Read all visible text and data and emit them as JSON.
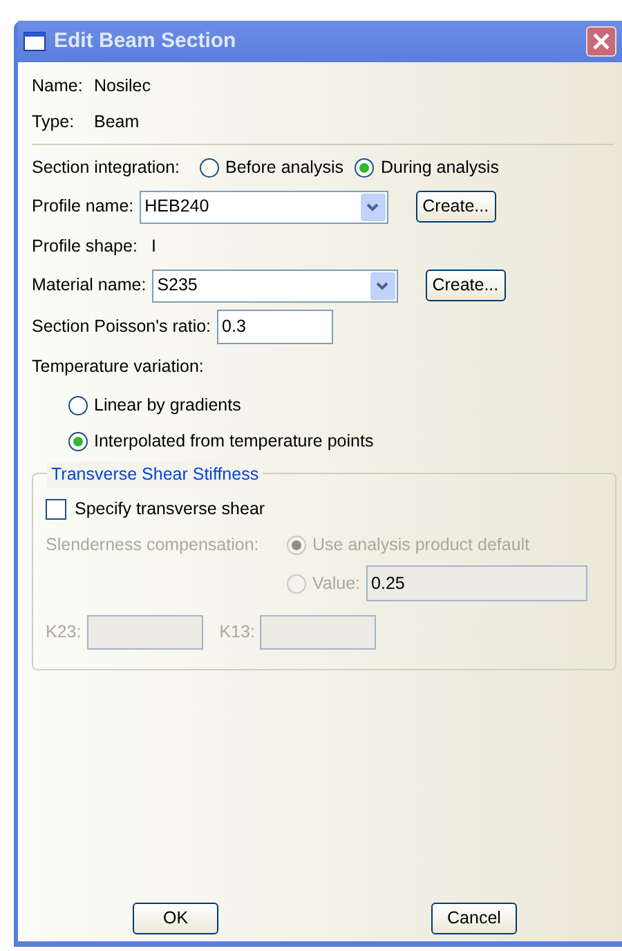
{
  "window": {
    "title": "Edit Beam Section"
  },
  "info": [
    {
      "label": "Name:",
      "value": "Nosilec"
    },
    {
      "label": "Type:",
      "value": "Beam"
    }
  ],
  "section_integration": {
    "label": "Section integration:",
    "options": [
      {
        "label": "Before analysis",
        "selected": false
      },
      {
        "label": "During analysis",
        "selected": true
      }
    ]
  },
  "profile_name": {
    "label": "Profile name:",
    "value": "HEB240",
    "button": "Create..."
  },
  "profile_shape": {
    "label": "Profile shape:",
    "value": "I"
  },
  "material_name": {
    "label": "Material name:",
    "value": "S235",
    "button": "Create..."
  },
  "poisson": {
    "label": "Section Poisson's ratio:",
    "value": "0.3"
  },
  "temperature_variation": {
    "label": "Temperature variation:",
    "options": [
      {
        "label": "Linear by gradients",
        "selected": false
      },
      {
        "label": "Interpolated from temperature points",
        "selected": true
      }
    ]
  },
  "transverse_shear": {
    "title": "Transverse Shear Stiffness",
    "specify": {
      "label": "Specify transverse shear",
      "checked": false
    },
    "disabled": true,
    "slenderness_label": "Slenderness compensation:",
    "options": [
      {
        "label": "Use analysis product default",
        "selected": true
      },
      {
        "label": "Value:",
        "selected": false,
        "value": "0.25"
      }
    ],
    "k_fields": [
      {
        "label": "K23:"
      },
      {
        "label": "K13:"
      }
    ]
  },
  "buttons": [
    "OK",
    "Cancel"
  ]
}
